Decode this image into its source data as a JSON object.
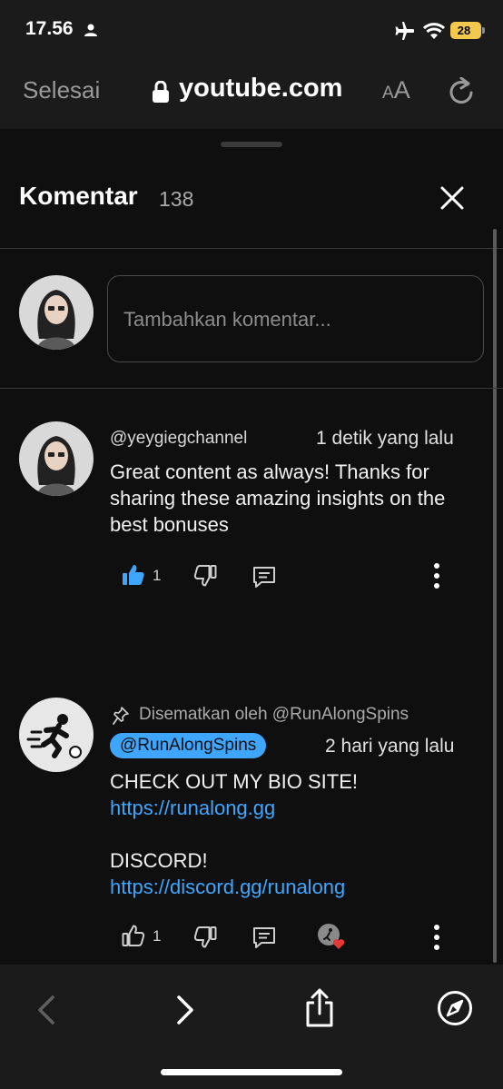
{
  "status": {
    "time": "17.56",
    "battery": "28"
  },
  "browser": {
    "done_label": "Selesai",
    "url": "youtube.com",
    "text_size_big": "A",
    "text_size_small": "A"
  },
  "sheet": {
    "title": "Komentar",
    "count": "138",
    "input_placeholder": "Tambahkan komentar..."
  },
  "comments": [
    {
      "author": "@yeygiegchannel",
      "time": "1 detik yang lalu",
      "text": "Great content as always! Thanks for sharing these amazing insights on the best bonuses",
      "likes": "1"
    },
    {
      "pinned_label": "Disematkan oleh @RunAlongSpins",
      "author": "@RunAlongSpins",
      "time": "2 hari yang lalu",
      "line1": "CHECK OUT MY BIO SITE!",
      "link1": "https://runalong.gg",
      "line2": "DISCORD!",
      "link2": "https://discord.gg/runalong",
      "likes": "1"
    }
  ],
  "colors": {
    "accent_blue": "#3ea6ff",
    "background": "#0f0f0f",
    "toolbar": "#1b1b1b",
    "battery": "#f2c94c"
  }
}
